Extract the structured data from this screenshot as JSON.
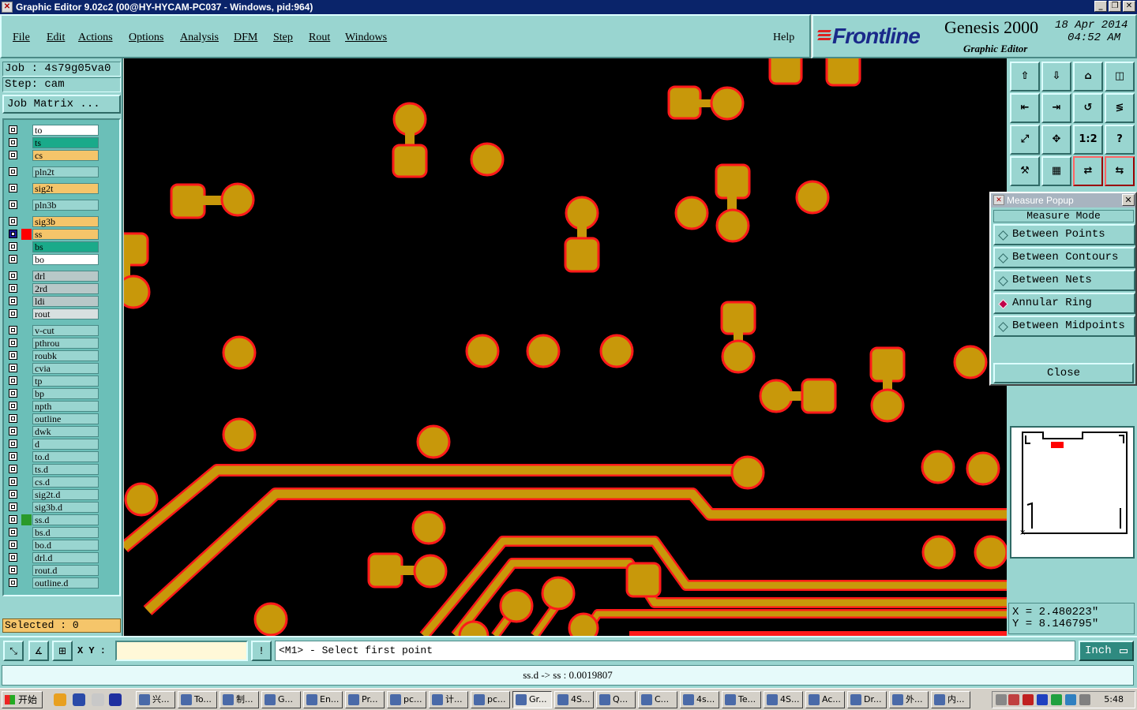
{
  "window": {
    "title": "Graphic Editor 9.02c2 (00@HY-HYCAM-PC037 - Windows, pid:964)",
    "icon": "app-icon"
  },
  "menubar": {
    "file": "File",
    "edit": "Edit",
    "actions": "Actions",
    "options": "Options",
    "analysis": "Analysis",
    "dfm": "DFM",
    "step": "Step",
    "rout": "Rout",
    "windows": "Windows",
    "help": "Help"
  },
  "brand": {
    "logo": "Frontline",
    "product": "Genesis 2000",
    "subtitle": "Graphic Editor",
    "date": "18 Apr 2014",
    "time": "04:52 AM"
  },
  "job": {
    "job_line": "Job : 4s79g05va0",
    "step_line": "Step: cam",
    "matrix_button": "Job Matrix ..."
  },
  "layers": [
    {
      "name": "to",
      "color": "#ffffff"
    },
    {
      "name": "ts",
      "color": "#1aaa8a"
    },
    {
      "name": "cs",
      "color": "#f5c56a"
    },
    {
      "name": "pln2t",
      "color": "#99d5d0"
    },
    {
      "name": "sig2t",
      "color": "#f5c56a"
    },
    {
      "name": "pln3b",
      "color": "#99d5d0"
    },
    {
      "name": "sig3b",
      "color": "#f5c56a"
    },
    {
      "name": "ss",
      "color": "#f5c56a"
    },
    {
      "name": "bs",
      "color": "#1aaa8a"
    },
    {
      "name": "bo",
      "color": "#ffffff"
    },
    {
      "name": "drl",
      "color": "#b8c8c8"
    },
    {
      "name": "2rd",
      "color": "#b8c8c8"
    },
    {
      "name": "ldi",
      "color": "#b8c8c8"
    },
    {
      "name": "rout",
      "color": "#d8e0e0"
    },
    {
      "name": "v-cut",
      "color": "#99d5d0"
    },
    {
      "name": "pthrou",
      "color": "#99d5d0"
    },
    {
      "name": "roubk",
      "color": "#99d5d0"
    },
    {
      "name": "cvia",
      "color": "#99d5d0"
    },
    {
      "name": "tp",
      "color": "#99d5d0"
    },
    {
      "name": "bp",
      "color": "#99d5d0"
    },
    {
      "name": "npth",
      "color": "#99d5d0"
    },
    {
      "name": "outline",
      "color": "#99d5d0"
    },
    {
      "name": "dwk",
      "color": "#99d5d0"
    },
    {
      "name": "d",
      "color": "#99d5d0"
    },
    {
      "name": "to.d",
      "color": "#99d5d0"
    },
    {
      "name": "ts.d",
      "color": "#99d5d0"
    },
    {
      "name": "cs.d",
      "color": "#99d5d0"
    },
    {
      "name": "sig2t.d",
      "color": "#99d5d0"
    },
    {
      "name": "sig3b.d",
      "color": "#99d5d0"
    },
    {
      "name": "ss.d",
      "color": "#99d5d0"
    },
    {
      "name": "bs.d",
      "color": "#99d5d0"
    },
    {
      "name": "bo.d",
      "color": "#99d5d0"
    },
    {
      "name": "drl.d",
      "color": "#99d5d0"
    },
    {
      "name": "rout.d",
      "color": "#99d5d0"
    },
    {
      "name": "outline.d",
      "color": "#99d5d0"
    }
  ],
  "selected": "Selected : 0",
  "toolbar_icons": [
    "open-step-icon",
    "save-step-icon",
    "home-icon",
    "window-icon",
    "zoom-left-icon",
    "zoom-right-icon",
    "undo-zoom-icon",
    "snap-icon",
    "fit-icon",
    "center-icon",
    "scale-1-2-icon",
    "help-icon",
    "tools-icon",
    "grid-icon",
    "layer-compare-icon",
    "layer-swap-icon"
  ],
  "toolbar_scale_label": "1:2",
  "measure_popup": {
    "title": "Measure Popup",
    "mode_header": "Measure Mode",
    "options": [
      "Between Points",
      "Between Contours",
      "Between Nets",
      "Annular Ring",
      "Between Midpoints"
    ],
    "selected_option": "Annular Ring",
    "close": "Close"
  },
  "coordinates": {
    "x": "X = 2.480223\"",
    "y": "Y = 8.146795\""
  },
  "command": {
    "xy_label": "X Y :",
    "xy_value": "",
    "info_button": "!",
    "prompt": "<M1> - Select first point",
    "units": "Inch"
  },
  "status": "ss.d -> ss : 0.0019807",
  "colors": {
    "panel": "#99d5d0",
    "copper": "#c8980a",
    "copper_outline": "#ff1a1a",
    "canvas": "#000000"
  },
  "taskbar": {
    "start": "开始",
    "tasks": [
      "兴...",
      "To...",
      "制...",
      "G...",
      "En...",
      "Pr...",
      "pc...",
      "计...",
      "pc...",
      "Gr...",
      "4S...",
      "Q...",
      "C...",
      "4s...",
      "Te...",
      "4S...",
      "Ac...",
      "Dr...",
      "外...",
      "内..."
    ],
    "active_task": "Gr...",
    "clock": "5:48"
  }
}
